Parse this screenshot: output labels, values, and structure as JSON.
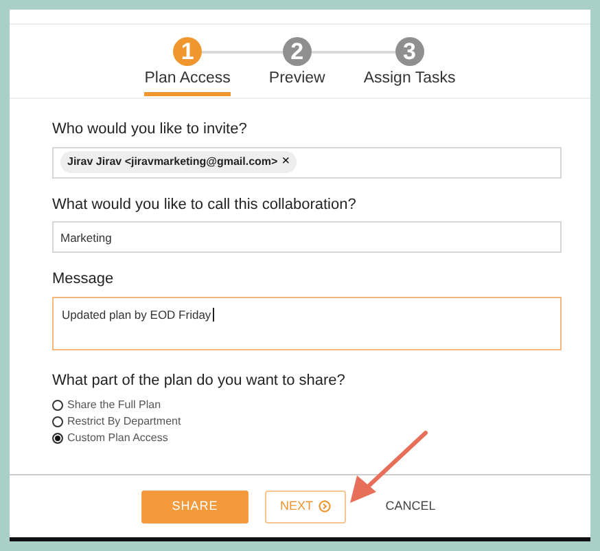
{
  "steps": [
    {
      "number": "1",
      "label": "Plan Access",
      "selected": true
    },
    {
      "number": "2",
      "label": "Preview",
      "selected": false
    },
    {
      "number": "3",
      "label": "Assign Tasks",
      "selected": false
    }
  ],
  "invite": {
    "label": "Who would you like to invite?",
    "chips": [
      {
        "text": "Jirav Jirav <jiravmarketing@gmail.com>",
        "remove": "×"
      }
    ]
  },
  "collaboration": {
    "label": "What would you like to call this collaboration?",
    "value": "Marketing"
  },
  "message": {
    "label": "Message",
    "value": "Updated plan by EOD Friday",
    "focused": true
  },
  "share": {
    "label": "What part of the plan do you want to share?",
    "options": [
      {
        "label": "Share the Full Plan",
        "selected": false
      },
      {
        "label": "Restrict By Department",
        "selected": false
      },
      {
        "label": "Custom Plan Access",
        "selected": true
      }
    ]
  },
  "buttons": [
    {
      "kind": "primary",
      "label": "SHARE"
    },
    {
      "kind": "outline",
      "label": "NEXT"
    },
    {
      "kind": "link",
      "label": "CANCEL"
    }
  ]
}
